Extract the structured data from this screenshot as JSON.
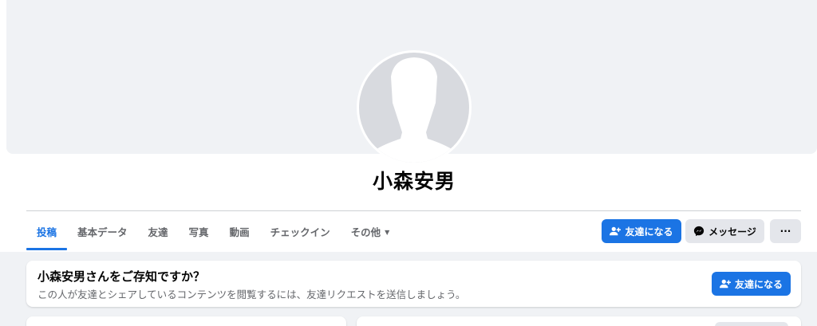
{
  "profile": {
    "name": "小森安男"
  },
  "tabs": [
    {
      "label": "投稿"
    },
    {
      "label": "基本データ"
    },
    {
      "label": "友達"
    },
    {
      "label": "写真"
    },
    {
      "label": "動画"
    },
    {
      "label": "チェックイン"
    },
    {
      "label": "その他"
    }
  ],
  "actions": {
    "add_friend_label": "友達になる",
    "message_label": "メッセージ",
    "more_label": "···"
  },
  "know_card": {
    "title": "小森安男さんをご存知ですか？",
    "subtitle": "この人が友達とシェアしているコンテンツを閲覧するには、友達リクエストを送信しましょう。",
    "button_label": "友達になる"
  },
  "colors": {
    "accent": "#1b74e4",
    "background": "#f0f2f5",
    "secondary_button": "#e4e6eb",
    "muted_text": "#65676b"
  },
  "icons": {
    "add_friend": "person-plus-icon",
    "messenger": "messenger-icon",
    "dropdown": "caret-down-icon"
  }
}
